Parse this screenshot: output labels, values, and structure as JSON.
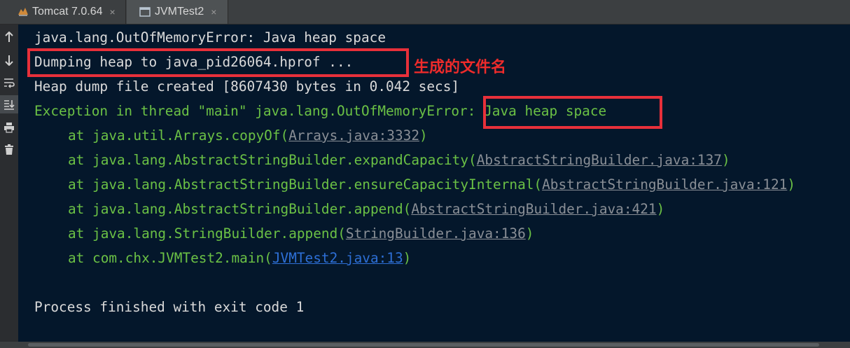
{
  "tabs": [
    {
      "label": "Tomcat 7.0.64",
      "icon": "tomcat-icon",
      "close": "×"
    },
    {
      "label": "JVMTest2",
      "icon": "run-config-icon",
      "close": "×"
    }
  ],
  "gutter": {
    "buttons": [
      {
        "name": "scroll-up-icon",
        "glyph": "↑"
      },
      {
        "name": "scroll-down-icon",
        "glyph": "↓"
      },
      {
        "name": "soft-wrap-icon",
        "glyph": "⇌"
      },
      {
        "name": "scroll-to-end-icon",
        "glyph": "⤓"
      },
      {
        "name": "print-icon",
        "glyph": "⎙"
      },
      {
        "name": "clear-all-icon",
        "glyph": "🗑"
      }
    ]
  },
  "console": {
    "line1": "java.lang.OutOfMemoryError: Java heap space",
    "line2": "Dumping heap to java_pid26064.hprof ...",
    "line3": "Heap dump file created [8607430 bytes in 0.042 secs]",
    "line4": "Exception in thread \"main\" java.lang.OutOfMemoryError: Java heap space",
    "stack": [
      {
        "prefix": "at java.util.Arrays.copyOf(",
        "link": "Arrays.java:3332",
        "suffix": ")"
      },
      {
        "prefix": "at java.lang.AbstractStringBuilder.expandCapacity(",
        "link": "AbstractStringBuilder.java:137",
        "suffix": ")"
      },
      {
        "prefix": "at java.lang.AbstractStringBuilder.ensureCapacityInternal(",
        "link": "AbstractStringBuilder.java:121",
        "suffix": ")"
      },
      {
        "prefix": "at java.lang.AbstractStringBuilder.append(",
        "link": "AbstractStringBuilder.java:421",
        "suffix": ")"
      },
      {
        "prefix": "at java.lang.StringBuilder.append(",
        "link": "StringBuilder.java:136",
        "suffix": ")"
      },
      {
        "prefix": "at com.chx.JVMTest2.main(",
        "link": "JVMTest2.java:13",
        "suffix": ")"
      }
    ],
    "exit": "Process finished with exit code 1"
  },
  "annotation": "生成的文件名",
  "colors": {
    "background": "#04172b",
    "text": "#dadada",
    "error_green": "#6bc145",
    "link_gray": "#8a8f96",
    "link_blue": "#2d6fd6",
    "highlight_red": "#e8303a"
  }
}
